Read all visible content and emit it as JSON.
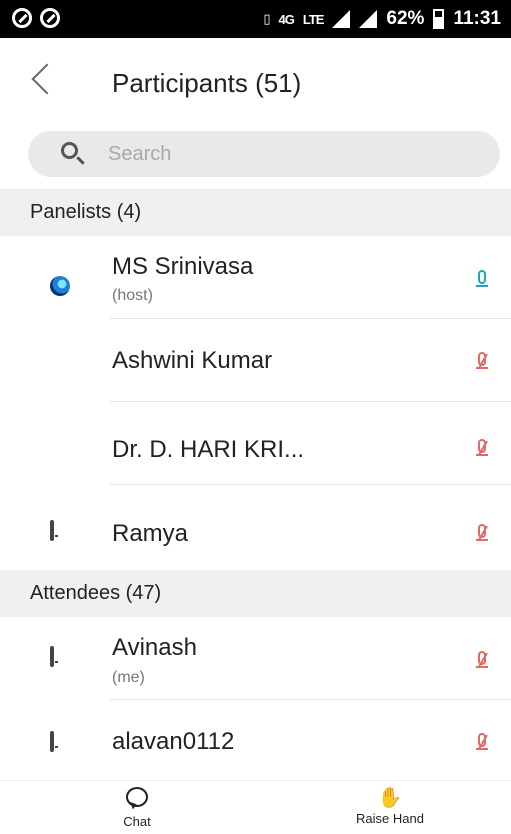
{
  "status_bar": {
    "network_label": "4G",
    "lte_label": "LTE",
    "battery": "62%",
    "time": "11:31"
  },
  "header": {
    "title": "Participants (51)"
  },
  "search": {
    "placeholder": "Search",
    "value": ""
  },
  "panelists": {
    "label": "Panelists (4)",
    "items": [
      {
        "name": "MS Srinivasa",
        "role": "(host)",
        "icon": "webex-logo-icon",
        "mic": "on"
      },
      {
        "name": "Ashwini Kumar",
        "role": "",
        "icon": "",
        "mic": "muted"
      },
      {
        "name": "Dr. D. HARI KRI...",
        "role": "",
        "icon": "",
        "mic": "muted"
      },
      {
        "name": "Ramya",
        "role": "",
        "icon": "phone-icon",
        "mic": "muted"
      }
    ]
  },
  "attendees": {
    "label": "Attendees (47)",
    "items": [
      {
        "name": "Avinash",
        "role": "(me)",
        "icon": "phone-icon",
        "mic": "muted"
      },
      {
        "name": "alavan0112",
        "role": "",
        "icon": "phone-icon",
        "mic": "muted"
      }
    ]
  },
  "tabs": {
    "chat": "Chat",
    "raise_hand": "Raise Hand"
  },
  "colors": {
    "mic_on": "#1fa3bf",
    "mic_muted": "#e06a6a",
    "section_bg": "#f0f0f0",
    "search_bg": "#e9e9e9"
  }
}
